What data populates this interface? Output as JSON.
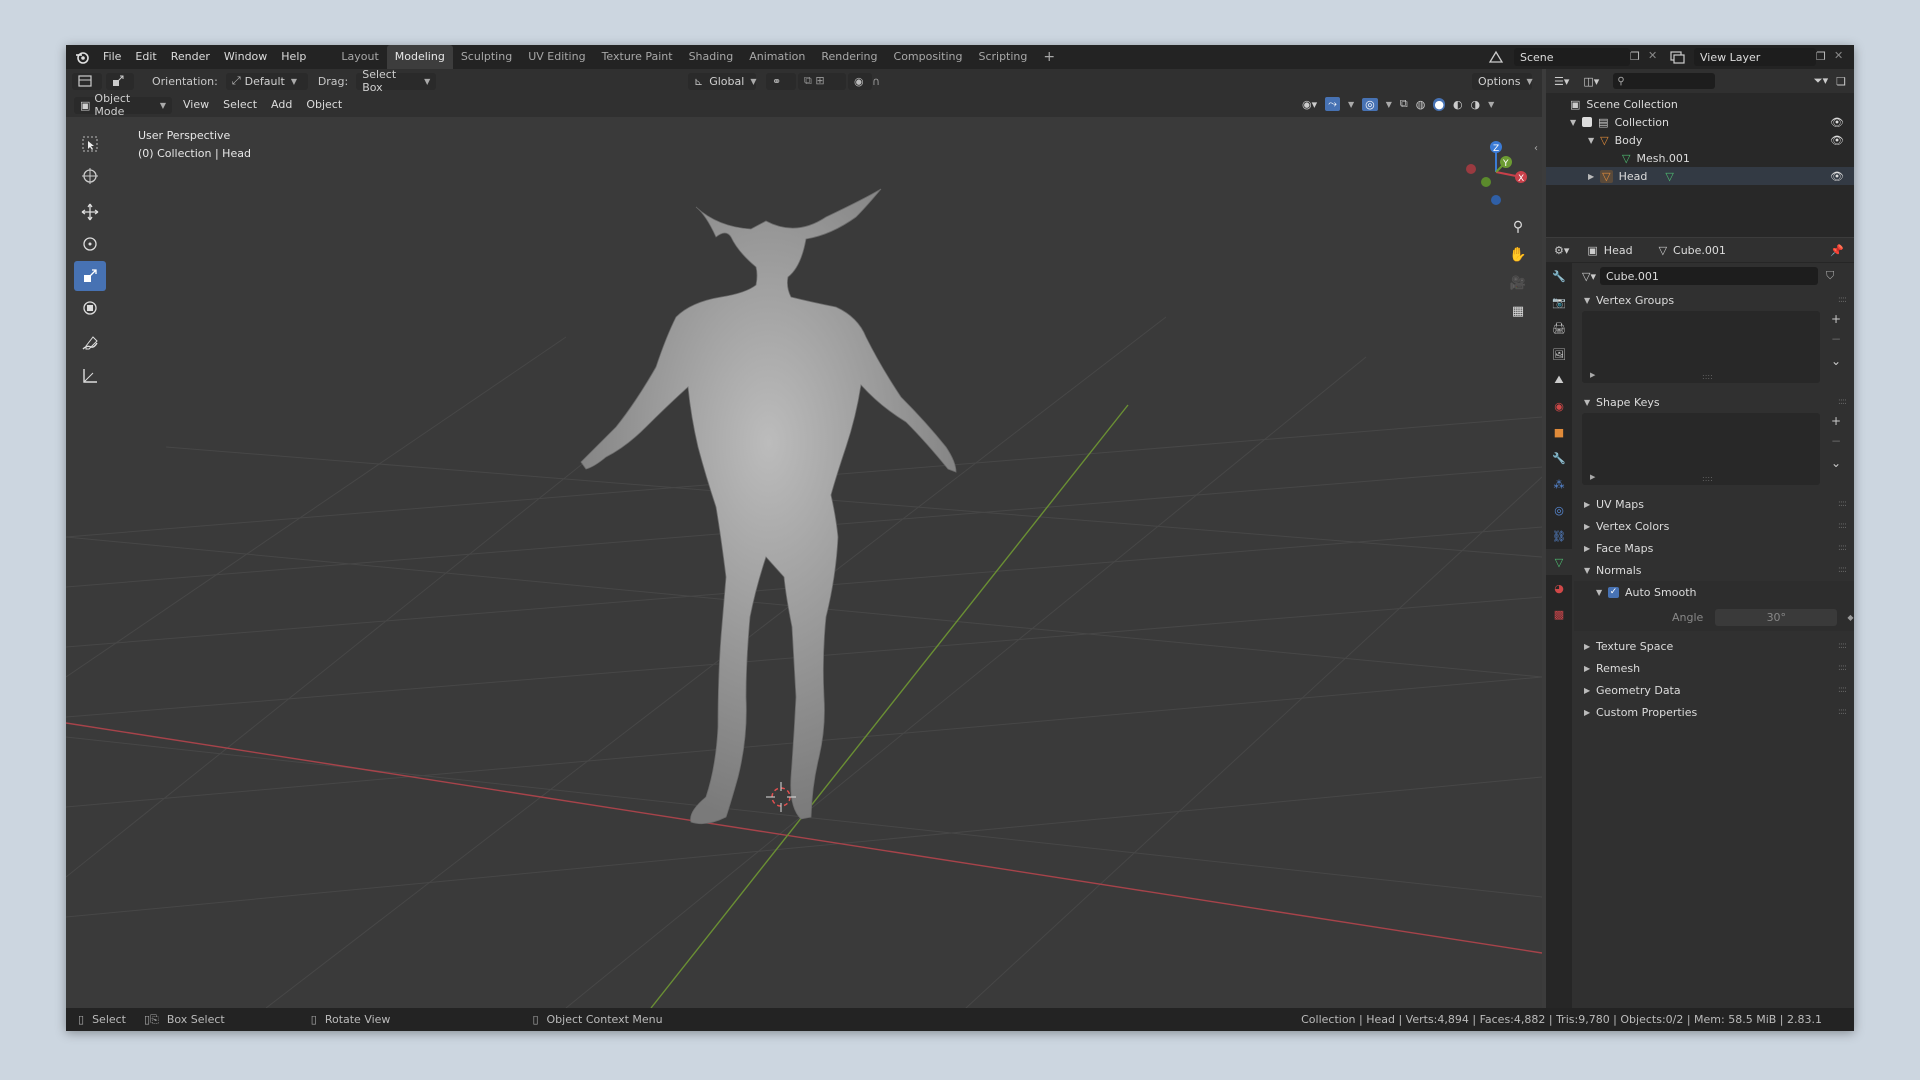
{
  "menubar": {
    "items": [
      "File",
      "Edit",
      "Render",
      "Window",
      "Help"
    ],
    "workspaces": [
      "Layout",
      "Modeling",
      "Sculpting",
      "UV Editing",
      "Texture Paint",
      "Shading",
      "Animation",
      "Rendering",
      "Compositing",
      "Scripting"
    ],
    "active_workspace": "Modeling",
    "add_tab": "+",
    "scene": "Scene",
    "view_layer": "View Layer"
  },
  "tool_header": {
    "orientation_label": "Orientation:",
    "orientation_value": "Default",
    "drag_label": "Drag:",
    "drag_value": "Select Box",
    "transform_orientation": "Global",
    "options": "Options"
  },
  "viewport_header": {
    "mode": "Object Mode",
    "menus": [
      "View",
      "Select",
      "Add",
      "Object"
    ]
  },
  "viewport": {
    "perspective": "User Perspective",
    "context": "(0) Collection | Head",
    "gizmo_axes": [
      "Z",
      "Y",
      "X"
    ]
  },
  "outliner": {
    "rows": [
      {
        "label": "Scene Collection"
      },
      {
        "label": "Collection"
      },
      {
        "label": "Body"
      },
      {
        "label": "Mesh.001"
      },
      {
        "label": "Head"
      }
    ]
  },
  "properties": {
    "object_name": "Head",
    "mesh_name": "Cube.001",
    "datablock": "Cube.001",
    "sections": {
      "vertex_groups": "Vertex Groups",
      "shape_keys": "Shape Keys",
      "uv_maps": "UV Maps",
      "vertex_colors": "Vertex Colors",
      "face_maps": "Face Maps",
      "normals": "Normals",
      "auto_smooth": "Auto Smooth",
      "angle_label": "Angle",
      "angle_value": "30°",
      "texture_space": "Texture Space",
      "remesh": "Remesh",
      "geometry_data": "Geometry Data",
      "custom_properties": "Custom Properties"
    }
  },
  "statusbar": {
    "select": "Select",
    "box_select": "Box Select",
    "rotate_view": "Rotate View",
    "context_menu": "Object Context Menu",
    "stats": "Collection | Head | Verts:4,894 | Faces:4,882 | Tris:9,780 | Objects:0/2 | Mem: 58.5 MiB | 2.83.1"
  },
  "colors": {
    "accent": "#4772b3",
    "x_axis": "#c9404a",
    "y_axis": "#6c9b32",
    "z_axis": "#3b7bd6"
  }
}
